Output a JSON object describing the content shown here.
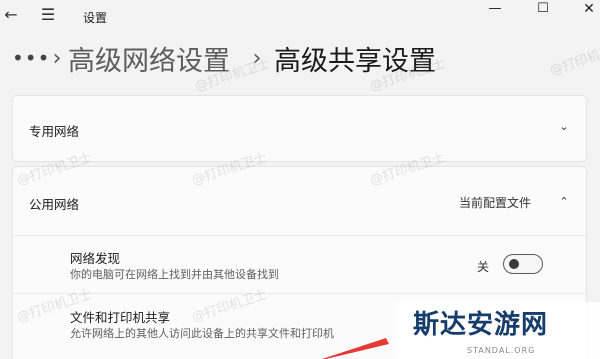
{
  "window": {
    "title": "设置",
    "back_glyph": "←",
    "menu_glyph": "☰",
    "minimize_glyph": "—",
    "maximize_glyph": "☐",
    "close_glyph": "✕"
  },
  "breadcrumb": {
    "more": "•••",
    "separator": "›",
    "parent": "高级网络设置",
    "current": "高级共享设置"
  },
  "sections": {
    "private": {
      "label": "专用网络",
      "expanded": false,
      "chevron": "⌄"
    },
    "public": {
      "label": "公用网络",
      "status": "当前配置文件",
      "expanded": true,
      "chevron": "⌃",
      "items": [
        {
          "title": "网络发现",
          "description": "你的电脑可在网络上找到并由其他设备找到",
          "toggle_state_label": "关",
          "toggle_on": false
        },
        {
          "title": "文件和打印机共享",
          "description": "允许网络上的其他人访问此设备上的共享文件和打印机"
        }
      ]
    }
  },
  "watermark_text": "@打印机卫士",
  "brand": {
    "name": "斯达安游网",
    "sub": "STANDAL.ORG"
  },
  "colors": {
    "window_bg": "#f3f3f3",
    "card_bg": "#fbfbfb",
    "brand_blue": "#153c6b",
    "arrow_red": "#e53935"
  }
}
